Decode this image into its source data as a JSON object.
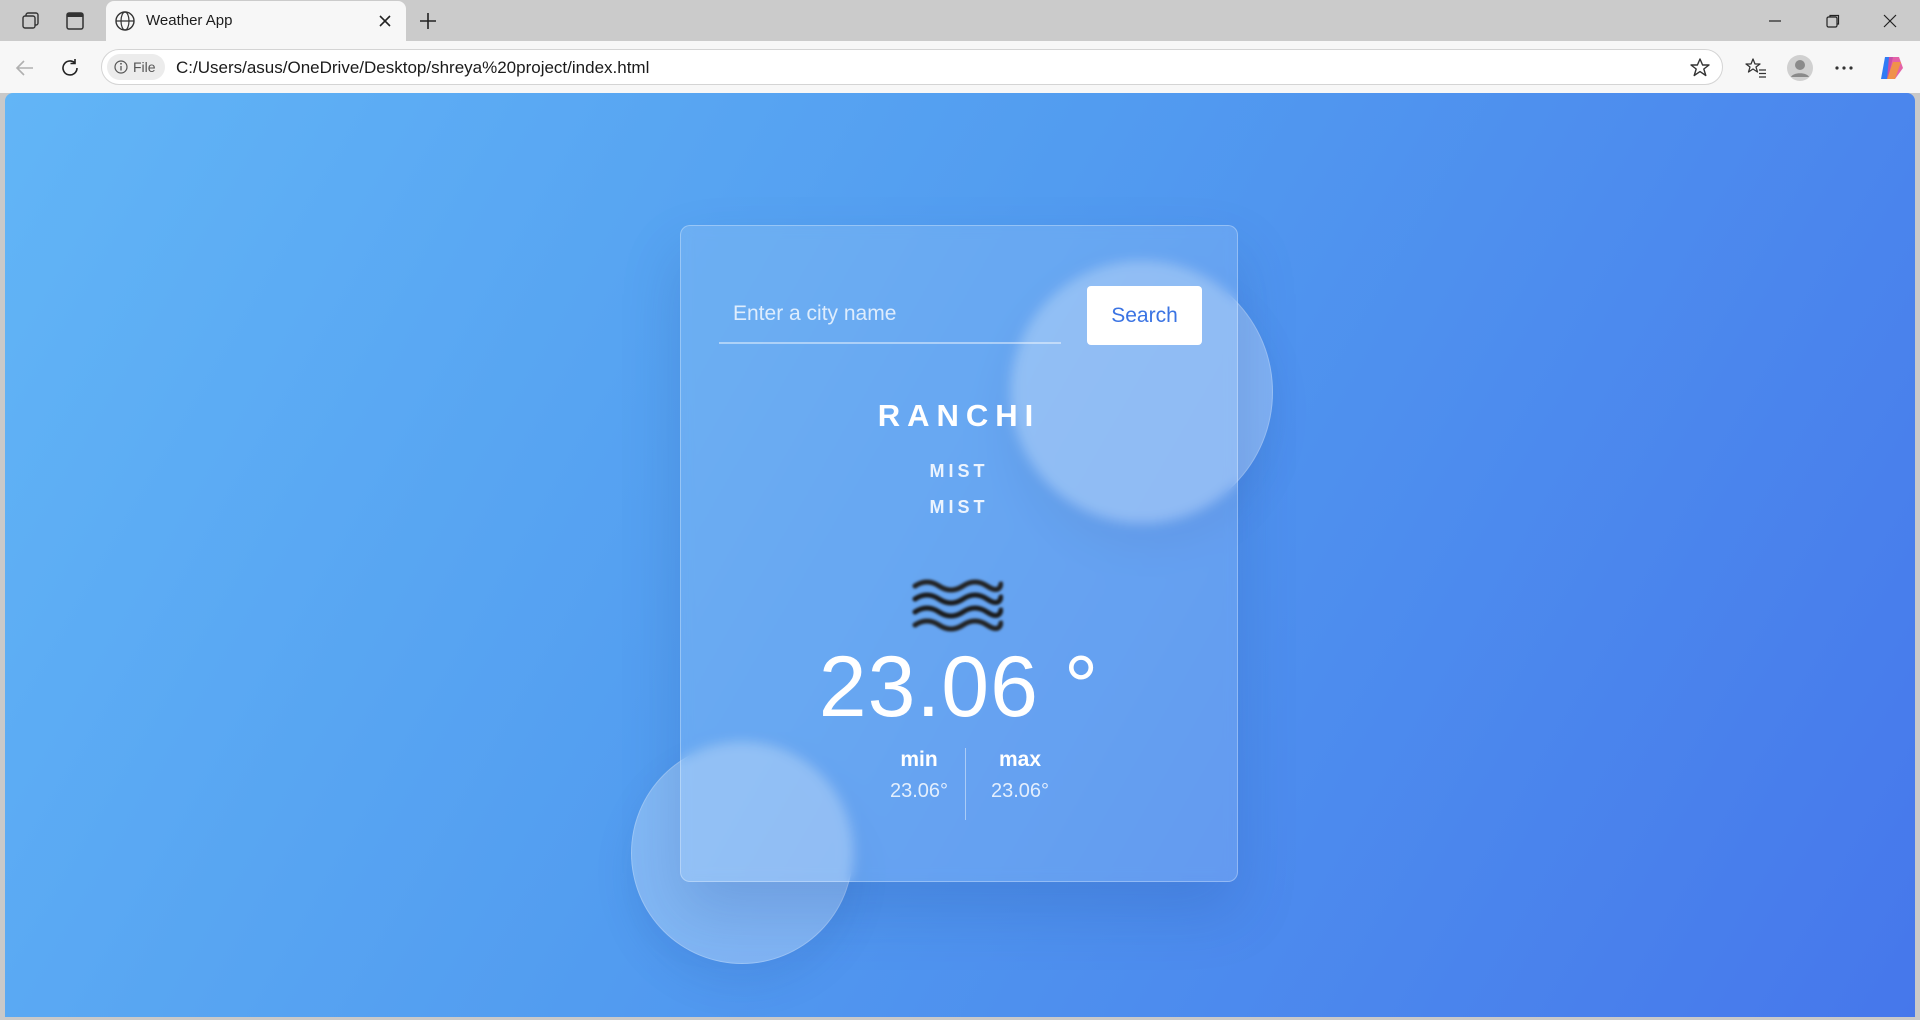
{
  "browser": {
    "tab": {
      "title": "Weather App"
    },
    "address": {
      "chip_label": "File",
      "url": "C:/Users/asus/OneDrive/Desktop/shreya%20project/index.html"
    },
    "icons": {
      "workspaces": "workspaces-icon",
      "tab_actions": "tab-actions-icon",
      "site": "globe-icon",
      "close_tab": "close-icon",
      "new_tab": "plus-icon",
      "minimize": "minimize-icon",
      "restore": "restore-icon",
      "close_window": "close-icon",
      "back": "back-arrow-icon",
      "refresh": "refresh-icon",
      "site_info": "info-icon",
      "favorite": "star-icon",
      "favorites": "favorites-icon",
      "profile": "profile-icon",
      "more": "more-icon",
      "copilot": "copilot-icon"
    }
  },
  "app": {
    "search": {
      "placeholder": "Enter a city name",
      "value": "",
      "button_label": "Search"
    },
    "weather": {
      "city": "RANCHI",
      "description_main": "MIST",
      "description_detail": "MIST",
      "icon": "mist-icon",
      "temperature": "23.06 °",
      "min_label": "min",
      "min_value": "23.06°",
      "max_label": "max",
      "max_value": "23.06°"
    },
    "colors": {
      "gradient_start": "#62b5f6",
      "gradient_end": "#4677eb",
      "button_text": "#3b74e3"
    }
  }
}
